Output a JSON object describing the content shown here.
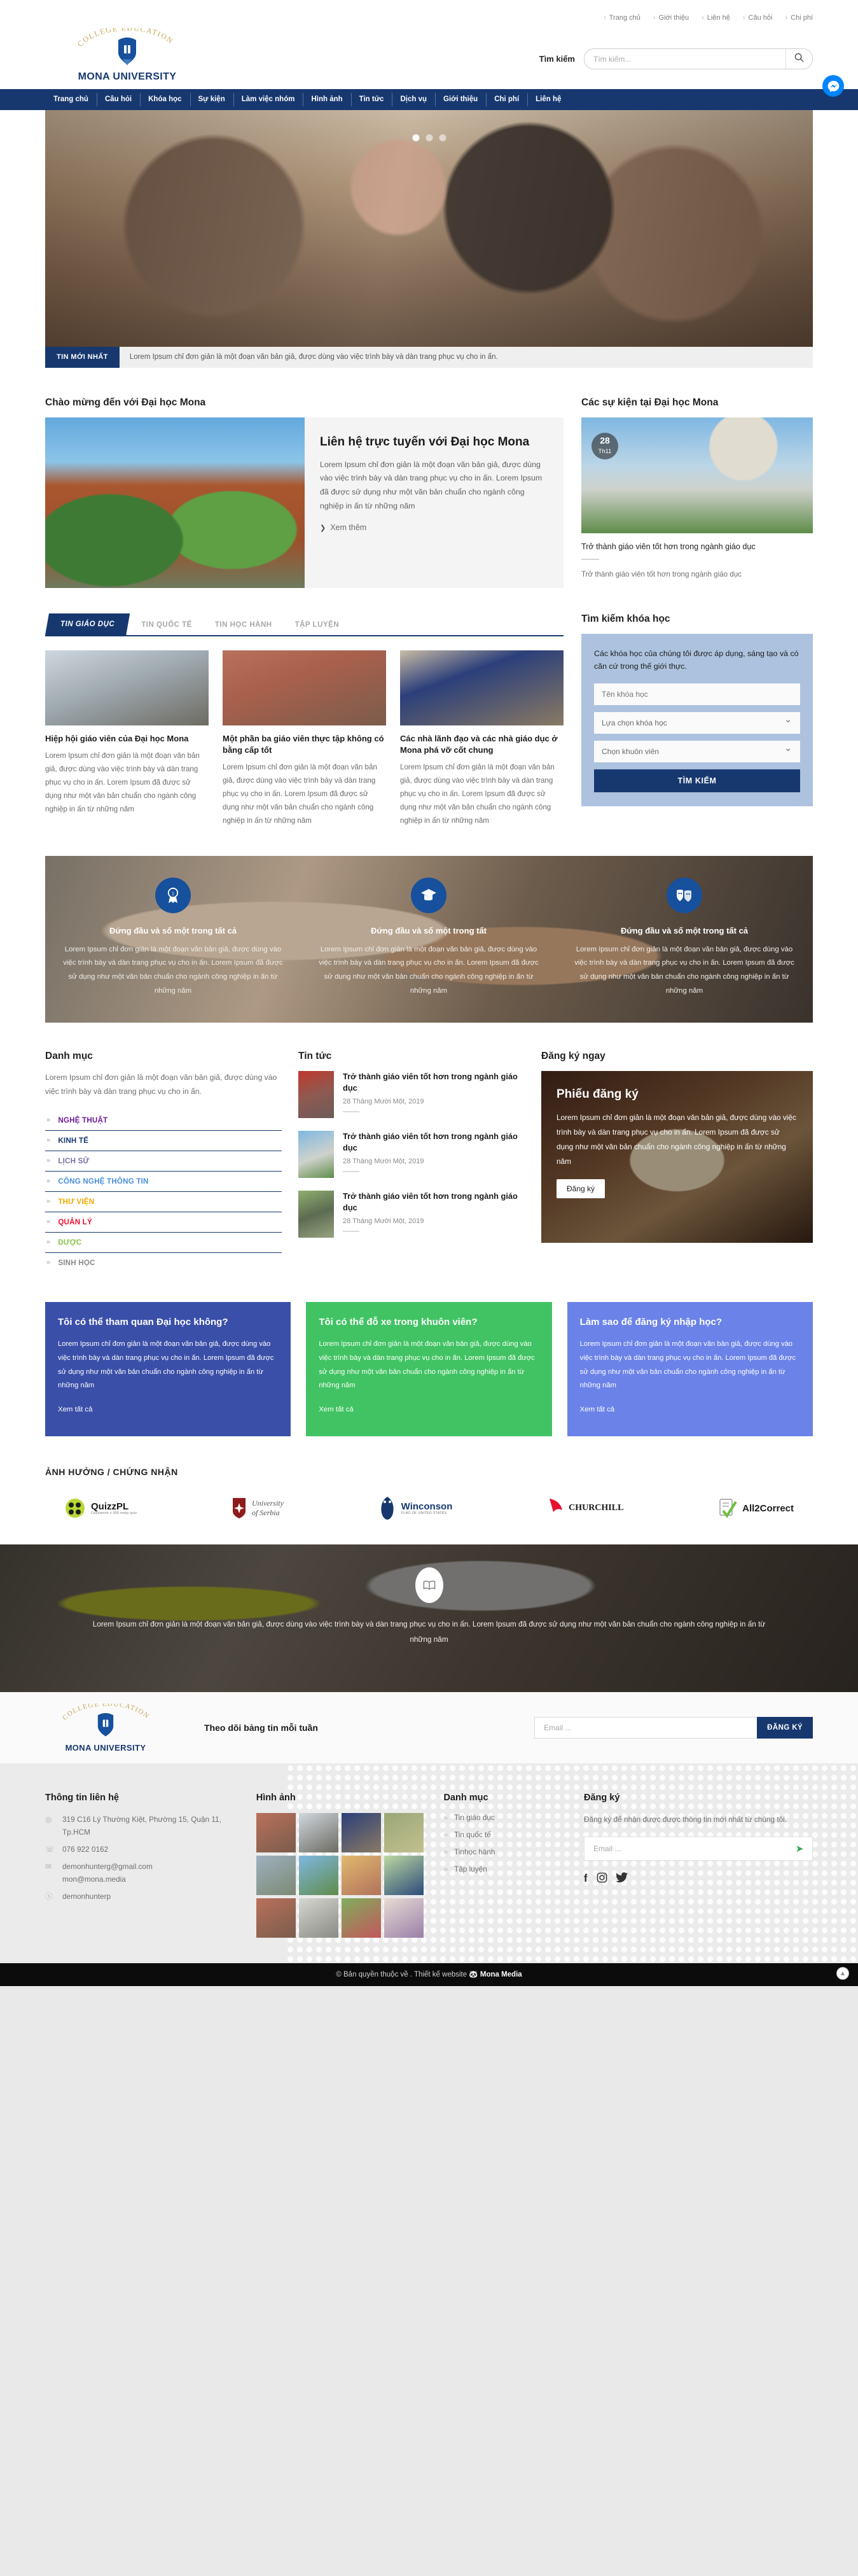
{
  "topnav": [
    "Trang chủ",
    "Giới thiệu",
    "Liên hệ",
    "Câu hỏi",
    "Chi phí"
  ],
  "brand": {
    "arc": "COLLEGE EDUCATION",
    "name": "MONA UNIVERSITY"
  },
  "search": {
    "label": "Tìm kiếm",
    "placeholder": "Tìm kiếm...",
    "value": "",
    "icon": "search-icon"
  },
  "mainnav": [
    "Trang chủ",
    "Câu hỏi",
    "Khóa học",
    "Sự kiện",
    "Làm việc nhóm",
    "Hình ảnh",
    "Tin tức",
    "Dịch vụ",
    "Giới thiệu",
    "Chi phí",
    "Liên hệ"
  ],
  "ticker": {
    "tag": "TIN MỚI NHẤT",
    "text": "Lorem Ipsum chỉ đơn giản là một đoạn văn bản giả, được dùng vào việc trình bày và dàn trang phục vụ cho in ấn."
  },
  "welcome": {
    "section_title": "Chào mừng đến với Đại học Mona",
    "heading": "Liên hệ trực tuyến với Đại học Mona",
    "body": "Lorem Ipsum chỉ đơn giản là một đoạn văn bản giả, được dùng vào việc trình bày và dàn trang phục vụ cho in ấn. Lorem Ipsum đã được sử dụng như một văn bản chuẩn cho ngành công nghiệp in ấn từ những năm",
    "more": "Xem thêm"
  },
  "events": {
    "section_title": "Các sự kiện tại Đại học Mona",
    "badge_day": "28",
    "badge_month": "Th11",
    "caption": "Trở thành giáo viên tốt hơn trong ngành giáo dục",
    "sub": "Trở thành giáo viên tốt hơn trong ngành giáo dục"
  },
  "tabs": {
    "items": [
      "TIN GIÁO DỤC",
      "TIN QUỐC TẾ",
      "TIN HỌC HÀNH",
      "TẬP LUYỆN"
    ],
    "active_index": 0,
    "cards": [
      {
        "title": "Hiệp hội giáo viên của Đại học Mona",
        "body": "Lorem Ipsum chỉ đơn giản là một đoạn văn bản giả, được dùng vào việc trình bày và dàn trang phục vụ cho in ấn. Lorem Ipsum đã được sử dụng như một văn bản chuẩn cho ngành công nghiệp in ấn từ những năm"
      },
      {
        "title": "Một phần ba giáo viên thực tập không có bằng cấp tốt",
        "body": "Lorem Ipsum chỉ đơn giản là một đoạn văn bản giả, được dùng vào việc trình bày và dàn trang phục vụ cho in ấn. Lorem Ipsum đã được sử dụng như một văn bản chuẩn cho ngành công nghiệp in ấn từ những năm"
      },
      {
        "title": "Các nhà lãnh đạo và các nhà giáo dục ở Mona phá vỡ cốt chung",
        "body": "Lorem Ipsum chỉ đơn giản là một đoạn văn bản giả, được dùng vào việc trình bày và dàn trang phục vụ cho in ấn. Lorem Ipsum đã được sử dụng như một văn bản chuẩn cho ngành công nghiệp in ấn từ những năm"
      }
    ]
  },
  "find": {
    "title": "Tìm kiếm khóa học",
    "lead": "Các khóa học của chúng tôi được áp dụng, sáng tạo và có căn cứ trong thế giới thực.",
    "name_placeholder": "Tên khóa học",
    "name_value": "",
    "course_select": "Lựa chọn khóa học",
    "campus_select": "Chọn khuôn viên",
    "button": "TÌM KIẾM"
  },
  "features": [
    {
      "icon": "award-ribbon-icon",
      "title": "Đứng đầu và số một trong tất cả",
      "body": "Lorem Ipsum chỉ đơn giản là một đoạn văn bản giả, được dùng vào việc trình bày và dàn trang phục vụ cho in ấn. Lorem Ipsum đã được sử dụng như một văn bản chuẩn cho ngành công nghiệp in ấn từ những năm"
    },
    {
      "icon": "graduation-cap-icon",
      "title": "Đứng đầu và số một trong tất",
      "body": "Lorem Ipsum chỉ đơn giản là một đoạn văn bản giả, được dùng vào việc trình bày và dàn trang phục vụ cho in ấn. Lorem Ipsum đã được sử dụng như một văn bản chuẩn cho ngành công nghiệp in ấn từ những năm"
    },
    {
      "icon": "theatre-masks-icon",
      "title": "Đứng đầu và số một trong tất cả",
      "body": "Lorem Ipsum chỉ đơn giản là một đoạn văn bản giả, được dùng vào việc trình bày và dàn trang phục vụ cho in ấn. Lorem Ipsum đã được sử dụng như một văn bản chuẩn cho ngành công nghiệp in ấn từ những năm"
    }
  ],
  "categories": {
    "title": "Danh mục",
    "intro": "Lorem Ipsum chỉ đơn giản là một đoạn văn bản giả, được dùng vào việc trình bày và dàn trang phục vụ cho in ấn.",
    "items": [
      {
        "label": "NGHỆ THUẬT",
        "color": "#6a1b9a"
      },
      {
        "label": "KINH TẾ",
        "color": "#17386f"
      },
      {
        "label": "LỊCH SỬ",
        "color": "#7a6ea8"
      },
      {
        "label": "CÔNG NGHỆ THÔNG TIN",
        "color": "#4a90d9"
      },
      {
        "label": "THƯ VIỆN",
        "color": "#f0ab00"
      },
      {
        "label": "QUẢN LÝ",
        "color": "#e8112d"
      },
      {
        "label": "DƯỢC",
        "color": "#8bc34a"
      },
      {
        "label": "SINH HỌC",
        "color": "#8a8a8a"
      }
    ]
  },
  "news": {
    "title": "Tin tức",
    "items": [
      {
        "title": "Trở thành giáo viên tốt hơn trong ngành giáo dục",
        "date": "28 Tháng Mười Một, 2019"
      },
      {
        "title": "Trở thành giáo viên tốt hơn trong ngành giáo dục",
        "date": "28 Tháng Mười Một, 2019"
      },
      {
        "title": "Trở thành giáo viên tốt hơn trong ngành giáo dục",
        "date": "28 Tháng Mười Một, 2019"
      }
    ]
  },
  "register": {
    "title": "Đăng ký ngay",
    "card_title": "Phiếu đăng ký",
    "card_body": "Lorem Ipsum chỉ đơn giản là một đoạn văn bản giả, được dùng vào việc trình bày và dàn trang phục vụ cho in ấn. Lorem Ipsum đã được sử dụng như một văn bản chuẩn cho ngành công nghiệp in ấn từ những năm",
    "button": "Đăng ký"
  },
  "faqs": [
    {
      "title": "Tôi có thể tham quan Đại học không?",
      "body": "Lorem Ipsum chỉ đơn giản là một đoạn văn bản giả, được dùng vào việc trình bày và dàn trang phục vụ cho in ấn. Lorem Ipsum đã được sử dụng như một văn bản chuẩn cho ngành công nghiệp in ấn từ những năm",
      "link": "Xem tất cả",
      "color": "#3a4fa8"
    },
    {
      "title": "Tôi có thể đỗ xe trong khuôn viên?",
      "body": "Lorem Ipsum chỉ đơn giản là một đoạn văn bản giả, được dùng vào việc trình bày và dàn trang phục vụ cho in ấn. Lorem Ipsum đã được sử dụng như một văn bản chuẩn cho ngành công nghiệp in ấn từ những năm",
      "link": "Xem tất cả",
      "color": "#41c363"
    },
    {
      "title": "Làm sao để đăng ký nhập học?",
      "body": "Lorem Ipsum chỉ đơn giản là một đoạn văn bản giả, được dùng vào việc trình bày và dàn trang phục vụ cho in ấn. Lorem Ipsum đã được sử dụng như một văn bản chuẩn cho ngành công nghiệp in ấn từ những năm",
      "link": "Xem tất cả",
      "color": "#6b82e8"
    }
  ],
  "partners": {
    "title": "ẢNH HƯỞNG / CHỨNG NHẬN",
    "items": [
      {
        "name": "QuizzPL",
        "sub": "Codzienne z 900 nowy quiz",
        "color": "#1a1a1a"
      },
      {
        "name": "University of Serbia",
        "sub": "",
        "color": "#8e1c1c"
      },
      {
        "name": "Winconson",
        "sub": "FLAG OF UNITED STATES",
        "color": "#17386f"
      },
      {
        "name": "CHURCHILL",
        "sub": "",
        "color": "#1a1a1a"
      },
      {
        "name": "All2Correct",
        "sub": "",
        "color": "#1a1a1a"
      }
    ]
  },
  "video_cta": {
    "icon": "open-book-icon",
    "text": "Lorem Ipsum chỉ đơn giản là một đoạn văn bản giả, được dùng vào việc trình bày và dàn trang phục vụ cho in ấn. Lorem Ipsum đã được sử dụng như một văn bản chuẩn cho ngành công nghiệp in ấn từ những năm"
  },
  "newsletter": {
    "text": "Theo dõi bảng tin mỗi tuần",
    "placeholder": "Email ...",
    "value": "",
    "button": "ĐĂNG KÝ"
  },
  "footer": {
    "contact": {
      "title": "Thông tin liên hệ",
      "address": "319 C16 Lý Thường Kiệt, Phường 15, Quận 11, Tp.HCM",
      "phone": "076 922 0162",
      "email1": "demonhunterg@gmail.com",
      "email2": "mon@mona.media",
      "skype": "demonhunterp"
    },
    "gallery_title": "Hình ảnh",
    "cats": {
      "title": "Danh mục",
      "items": [
        "Tin giáo dục",
        "Tin quốc tế",
        "Tinhọc hành",
        "Tập luyện"
      ]
    },
    "reg": {
      "title": "Đăng ký",
      "desc": "Đăng ký để nhận được được thông tin mới nhất từ chúng tôi.",
      "placeholder": "Email ...",
      "value": "",
      "socials": [
        "facebook-icon",
        "instagram-icon",
        "twitter-icon"
      ]
    },
    "copyright_pre": "© Bản quyền thuộc về . Thiết kế website",
    "copyright_brand": "Mona Media"
  },
  "widgets": {
    "messenger": "messenger-icon",
    "to_top": "scroll-to-top-icon"
  }
}
